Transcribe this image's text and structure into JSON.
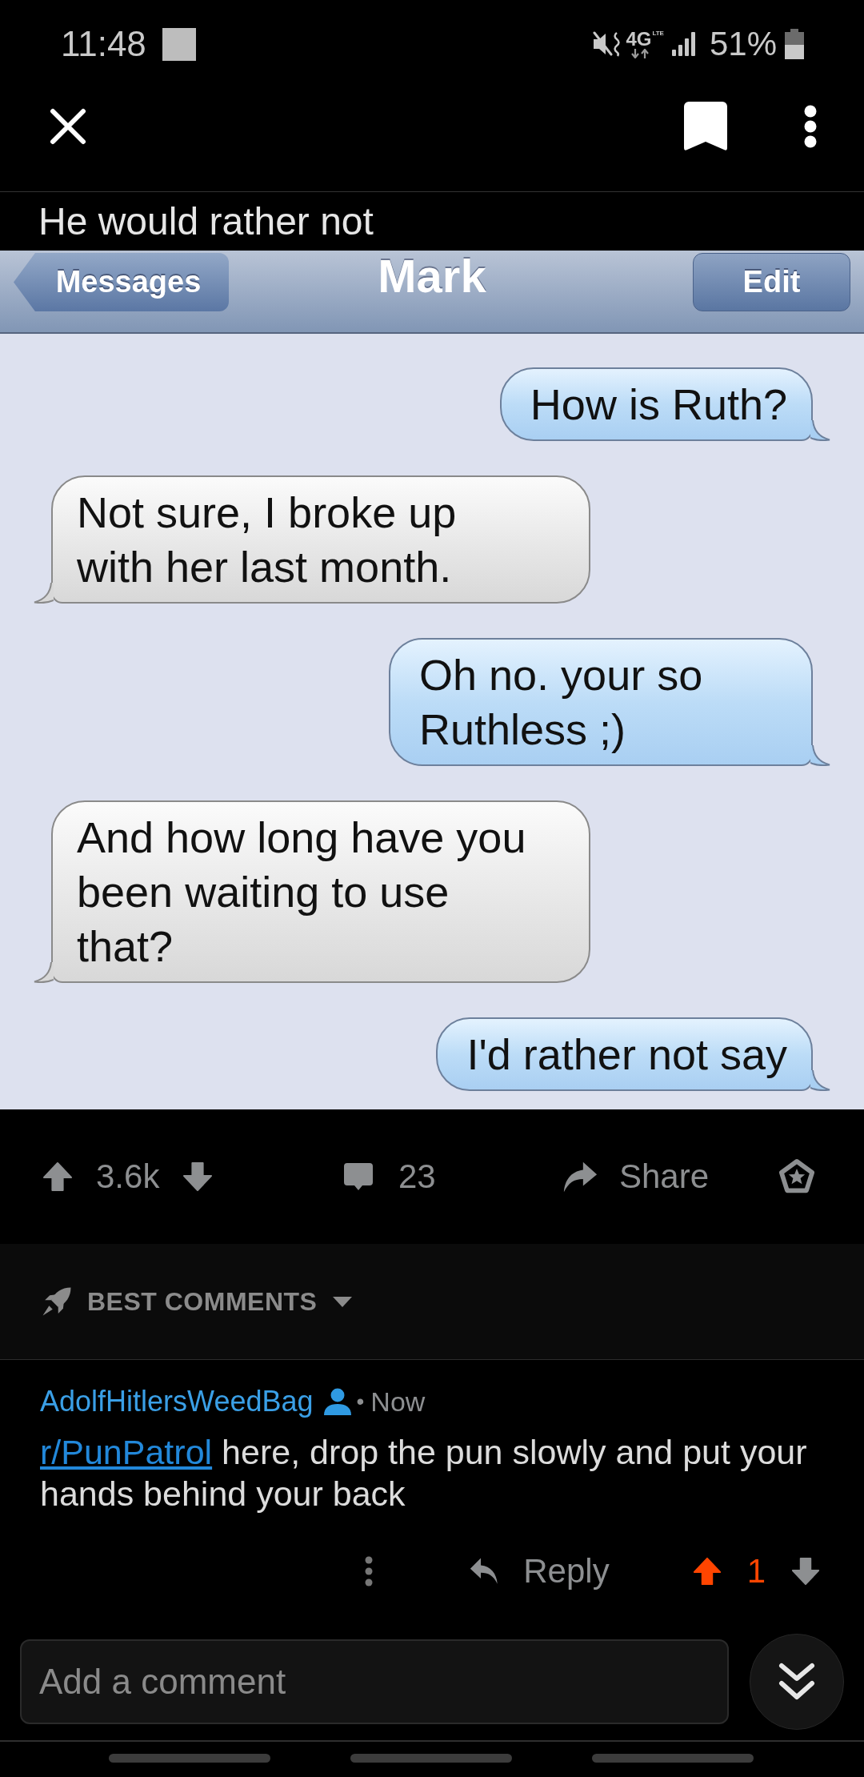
{
  "status_bar": {
    "time": "11:48",
    "network": "4G",
    "network_detail": "LTE",
    "battery": "51%"
  },
  "post": {
    "title": "He would rather not",
    "image": {
      "back": "Messages",
      "contact": "Mark",
      "edit": "Edit",
      "messages": [
        {
          "kind": "sent",
          "text": "How is Ruth?"
        },
        {
          "kind": "received",
          "text": "Not sure, I broke up with her last month."
        },
        {
          "kind": "sent",
          "text": "Oh no. your so Ruthless ;)"
        },
        {
          "kind": "received",
          "text": "And how long have you been waiting to use that?"
        },
        {
          "kind": "sent",
          "text": "I'd rather not say"
        }
      ]
    },
    "upvoted": false,
    "votes": "3.6k",
    "comments": "23",
    "share": "Share"
  },
  "comment_sort": {
    "label": "BEST COMMENTS"
  },
  "comments": [
    {
      "author": "AdolfHitlersWeedBag",
      "separator": "•",
      "time": "Now",
      "link": "r/PunPatrol",
      "text": "here, drop the pun slowly and put your hands behind your back",
      "reply": "Reply",
      "upvoted": true,
      "votes": "1"
    }
  ],
  "comment_box": {
    "placeholder": "Add a comment"
  }
}
